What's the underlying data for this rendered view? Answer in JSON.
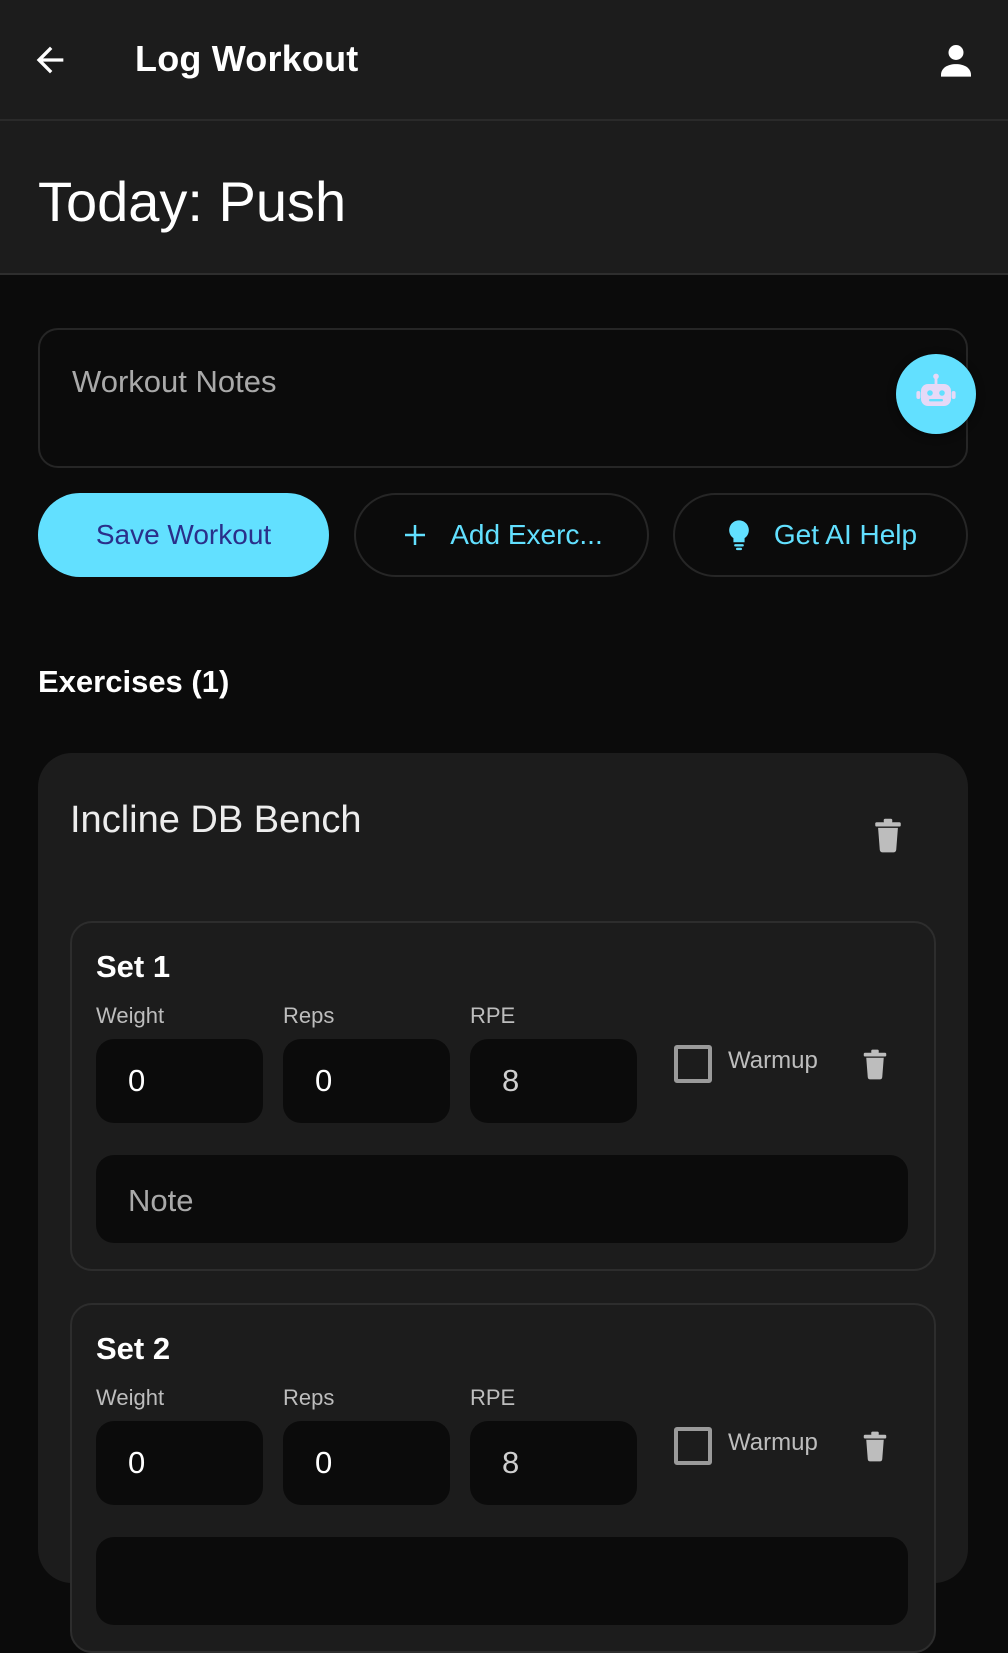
{
  "appbar": {
    "title": "Log Workout",
    "back_icon": "arrow-left-icon",
    "profile_icon": "user-icon"
  },
  "header": {
    "title": "Today: Push"
  },
  "notes": {
    "placeholder": "Workout Notes",
    "value": ""
  },
  "ai_fab": {
    "icon": "robot-icon"
  },
  "actions": {
    "save_label": "Save Workout",
    "add_label": "Add Exerc...",
    "ai_help_label": "Get AI Help"
  },
  "exercises_section": {
    "title": "Exercises (1)"
  },
  "exercises": [
    {
      "name": "Incline DB Bench",
      "sets": [
        {
          "title": "Set 1",
          "weight_label": "Weight",
          "weight": "0",
          "reps_label": "Reps",
          "reps": "0",
          "rpe_label": "RPE",
          "rpe": "8",
          "warmup_label": "Warmup",
          "warmup_checked": false,
          "note_placeholder": "Note"
        },
        {
          "title": "Set 2",
          "weight_label": "Weight",
          "weight": "0",
          "reps_label": "Reps",
          "reps": "0",
          "rpe_label": "RPE",
          "rpe": "8",
          "warmup_label": "Warmup",
          "warmup_checked": false,
          "note_placeholder": ""
        }
      ]
    }
  ],
  "colors": {
    "accent": "#62e0ff",
    "primary_button_text": "#2a2f8a",
    "background": "#0b0b0b",
    "surface": "#1c1c1c"
  }
}
